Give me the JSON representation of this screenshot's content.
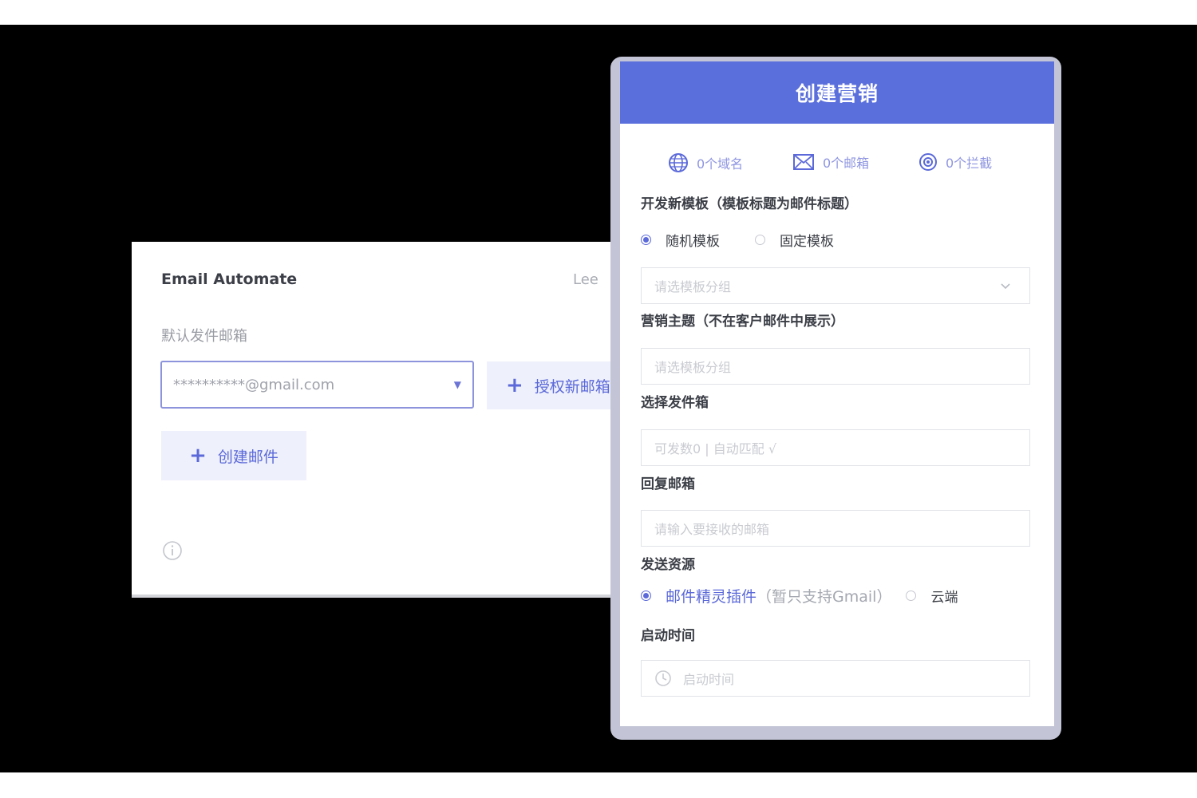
{
  "email_automate": {
    "title": "Email Automate",
    "user": "Lee",
    "default_sender_label": "默认发件邮箱",
    "sender_value": "**********@gmail.com",
    "authorize_button": "授权新邮箱",
    "create_mail_button": "创建邮件"
  },
  "campaign": {
    "header_title": "创建营销",
    "stats": [
      {
        "icon": "globe-icon",
        "label": "0个域名"
      },
      {
        "icon": "mail-icon",
        "label": "0个邮箱"
      },
      {
        "icon": "shield-target-icon",
        "label": "0个拦截"
      }
    ],
    "template_label": "开发新模板（模板标题为邮件标题）",
    "template_options": [
      "随机模板",
      "固定模板"
    ],
    "template_group_placeholder": "请选模板分组",
    "subject_label": "营销主题（不在客户邮件中展示）",
    "subject_placeholder": "请选模板分组",
    "sender_box_label": "选择发件箱",
    "sender_box_placeholder": "可发数0 | 自动匹配 √",
    "reply_label": "回复邮箱",
    "reply_placeholder": "请输入要接收的邮箱",
    "resource_label": "发送资源",
    "resource_option_plugin": "邮件精灵插件",
    "resource_option_plugin_note": "（暂只支持Gmail）",
    "resource_option_cloud": "云端",
    "start_time_label": "启动时间",
    "start_time_placeholder": "启动时间"
  },
  "colors": {
    "accent": "#5b69d9",
    "header_bg": "#5b6fdc",
    "button_bg": "#eef0fb"
  }
}
